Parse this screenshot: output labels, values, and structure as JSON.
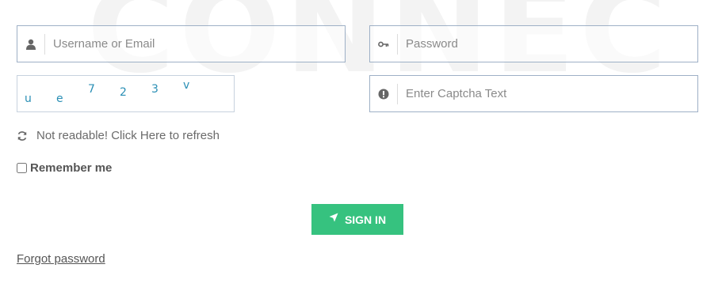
{
  "background_text": "CONNEC",
  "username": {
    "placeholder": "Username or Email",
    "icon": "user-icon"
  },
  "password": {
    "placeholder": "Password",
    "icon": "key-icon"
  },
  "captcha": {
    "chars": [
      "u",
      "e",
      "7",
      "2",
      "3",
      "v"
    ],
    "color": "#2a8fb5"
  },
  "captcha_input": {
    "placeholder": "Enter Captcha Text",
    "icon": "exclamation-circle-icon"
  },
  "refresh": {
    "label": "Not readable! Click Here to refresh",
    "icon": "refresh-icon"
  },
  "remember": {
    "label": "Remember me",
    "checked": false
  },
  "signin": {
    "label": "SIGN IN",
    "icon": "paper-plane-icon",
    "color": "#36c27f"
  },
  "forgot": {
    "label": "Forgot password"
  }
}
